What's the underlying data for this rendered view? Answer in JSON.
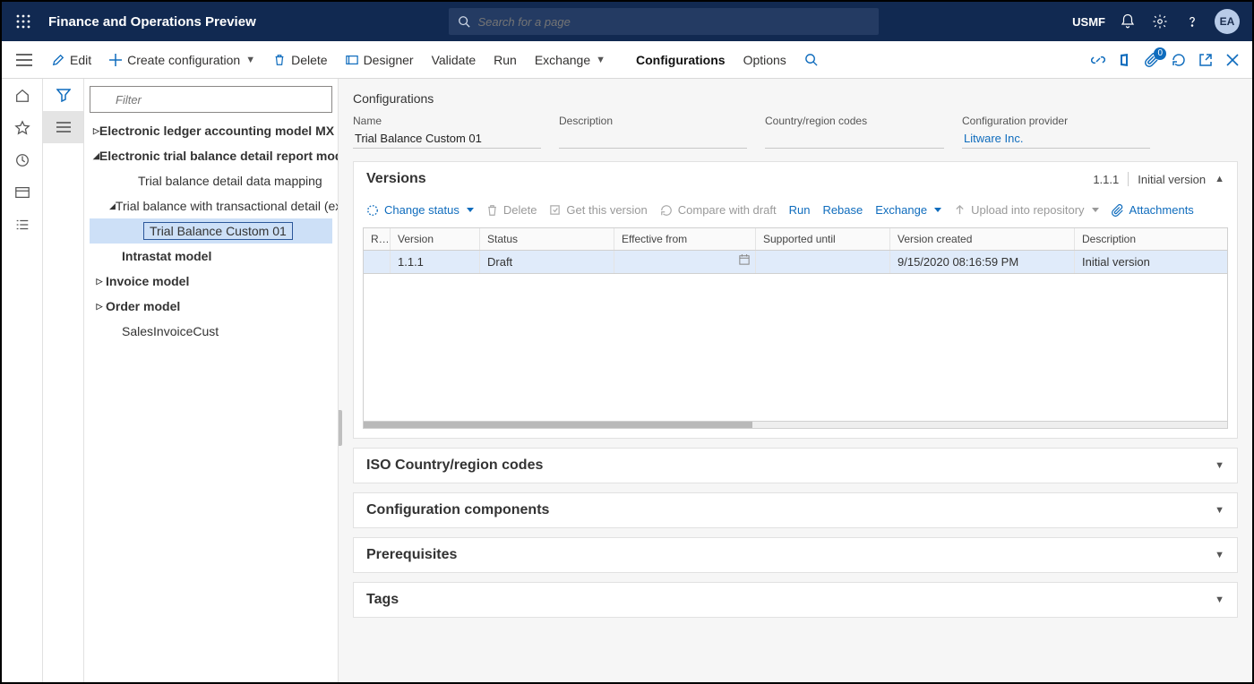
{
  "top": {
    "app_title": "Finance and Operations Preview",
    "search_placeholder": "Search for a page",
    "company": "USMF",
    "avatar": "EA"
  },
  "cmd": {
    "edit": "Edit",
    "create": "Create configuration",
    "delete": "Delete",
    "designer": "Designer",
    "validate": "Validate",
    "run": "Run",
    "exchange": "Exchange",
    "configurations": "Configurations",
    "options": "Options",
    "badge_count": "0"
  },
  "tree": {
    "filter_placeholder": "Filter",
    "items": [
      {
        "label": "Electronic ledger accounting model MX",
        "level": 1,
        "caret": "right",
        "bold": true
      },
      {
        "label": "Electronic trial balance detail report model",
        "level": 1,
        "caret": "down",
        "bold": true
      },
      {
        "label": "Trial balance detail data mapping",
        "level": 3,
        "caret": "",
        "bold": false
      },
      {
        "label": "Trial balance with transactional detail (excel)",
        "level": 2,
        "caret": "down",
        "bold": false
      },
      {
        "label": "Trial Balance Custom 01",
        "level": 4,
        "caret": "",
        "bold": false,
        "selected": true
      },
      {
        "label": "Intrastat model",
        "level": 2,
        "caret": "",
        "bold": true
      },
      {
        "label": "Invoice model",
        "level": 1,
        "caret": "right",
        "bold": true
      },
      {
        "label": "Order model",
        "level": 1,
        "caret": "right",
        "bold": true
      },
      {
        "label": "SalesInvoiceCust",
        "level": 2,
        "caret": "",
        "bold": false
      }
    ]
  },
  "detail": {
    "section_title": "Configurations",
    "fields": {
      "name_label": "Name",
      "name_value": "Trial Balance Custom 01",
      "description_label": "Description",
      "description_value": "",
      "country_label": "Country/region codes",
      "country_value": "",
      "provider_label": "Configuration provider",
      "provider_value": "Litware Inc."
    }
  },
  "versions": {
    "title": "Versions",
    "badge_version": "1.1.1",
    "badge_text": "Initial version",
    "toolbar": {
      "change_status": "Change status",
      "delete": "Delete",
      "get_version": "Get this version",
      "compare": "Compare with draft",
      "run": "Run",
      "rebase": "Rebase",
      "exchange": "Exchange",
      "upload": "Upload into repository",
      "attachments": "Attachments"
    },
    "columns": {
      "r": "R...",
      "version": "Version",
      "status": "Status",
      "effective": "Effective from",
      "supported": "Supported until",
      "created": "Version created",
      "description": "Description"
    },
    "row": {
      "version": "1.1.1",
      "status": "Draft",
      "effective": "",
      "supported": "",
      "created": "9/15/2020 08:16:59 PM",
      "description": "Initial version"
    }
  },
  "sections": {
    "iso": "ISO Country/region codes",
    "components": "Configuration components",
    "prereq": "Prerequisites",
    "tags": "Tags"
  }
}
